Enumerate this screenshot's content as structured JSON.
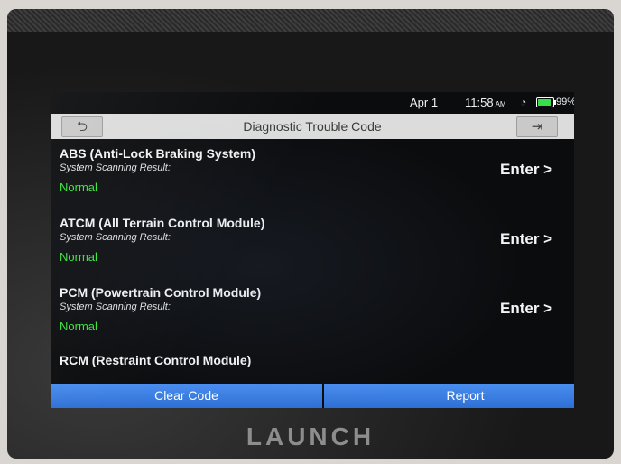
{
  "status_bar": {
    "date": "Apr 1",
    "time": "11:58",
    "ampm": "AM",
    "wifi_icon": "wifi-icon",
    "battery_percent": "99%",
    "battery_level": 0.99
  },
  "header": {
    "title": "Diagnostic Trouble Code",
    "back_icon": "back-arrow-icon",
    "exit_icon": "exit-door-icon"
  },
  "systems": [
    {
      "name": "ABS (Anti-Lock Braking System)",
      "result_label": "System Scanning Result:",
      "result": "Normal",
      "action": "Enter >"
    },
    {
      "name": "ATCM (All Terrain Control Module)",
      "result_label": "System Scanning Result:",
      "result": "Normal",
      "action": "Enter >"
    },
    {
      "name": "PCM (Powertrain Control Module)",
      "result_label": "System Scanning Result:",
      "result": "Normal",
      "action": "Enter >"
    },
    {
      "name": "RCM (Restraint Control Module)"
    }
  ],
  "footer": {
    "clear_label": "Clear Code",
    "report_label": "Report"
  },
  "device": {
    "brand": "LAUNCH"
  },
  "colors": {
    "accent_button": "#3a7fe3",
    "normal_status": "#39e639",
    "title_bar": "#dcdcdc"
  }
}
